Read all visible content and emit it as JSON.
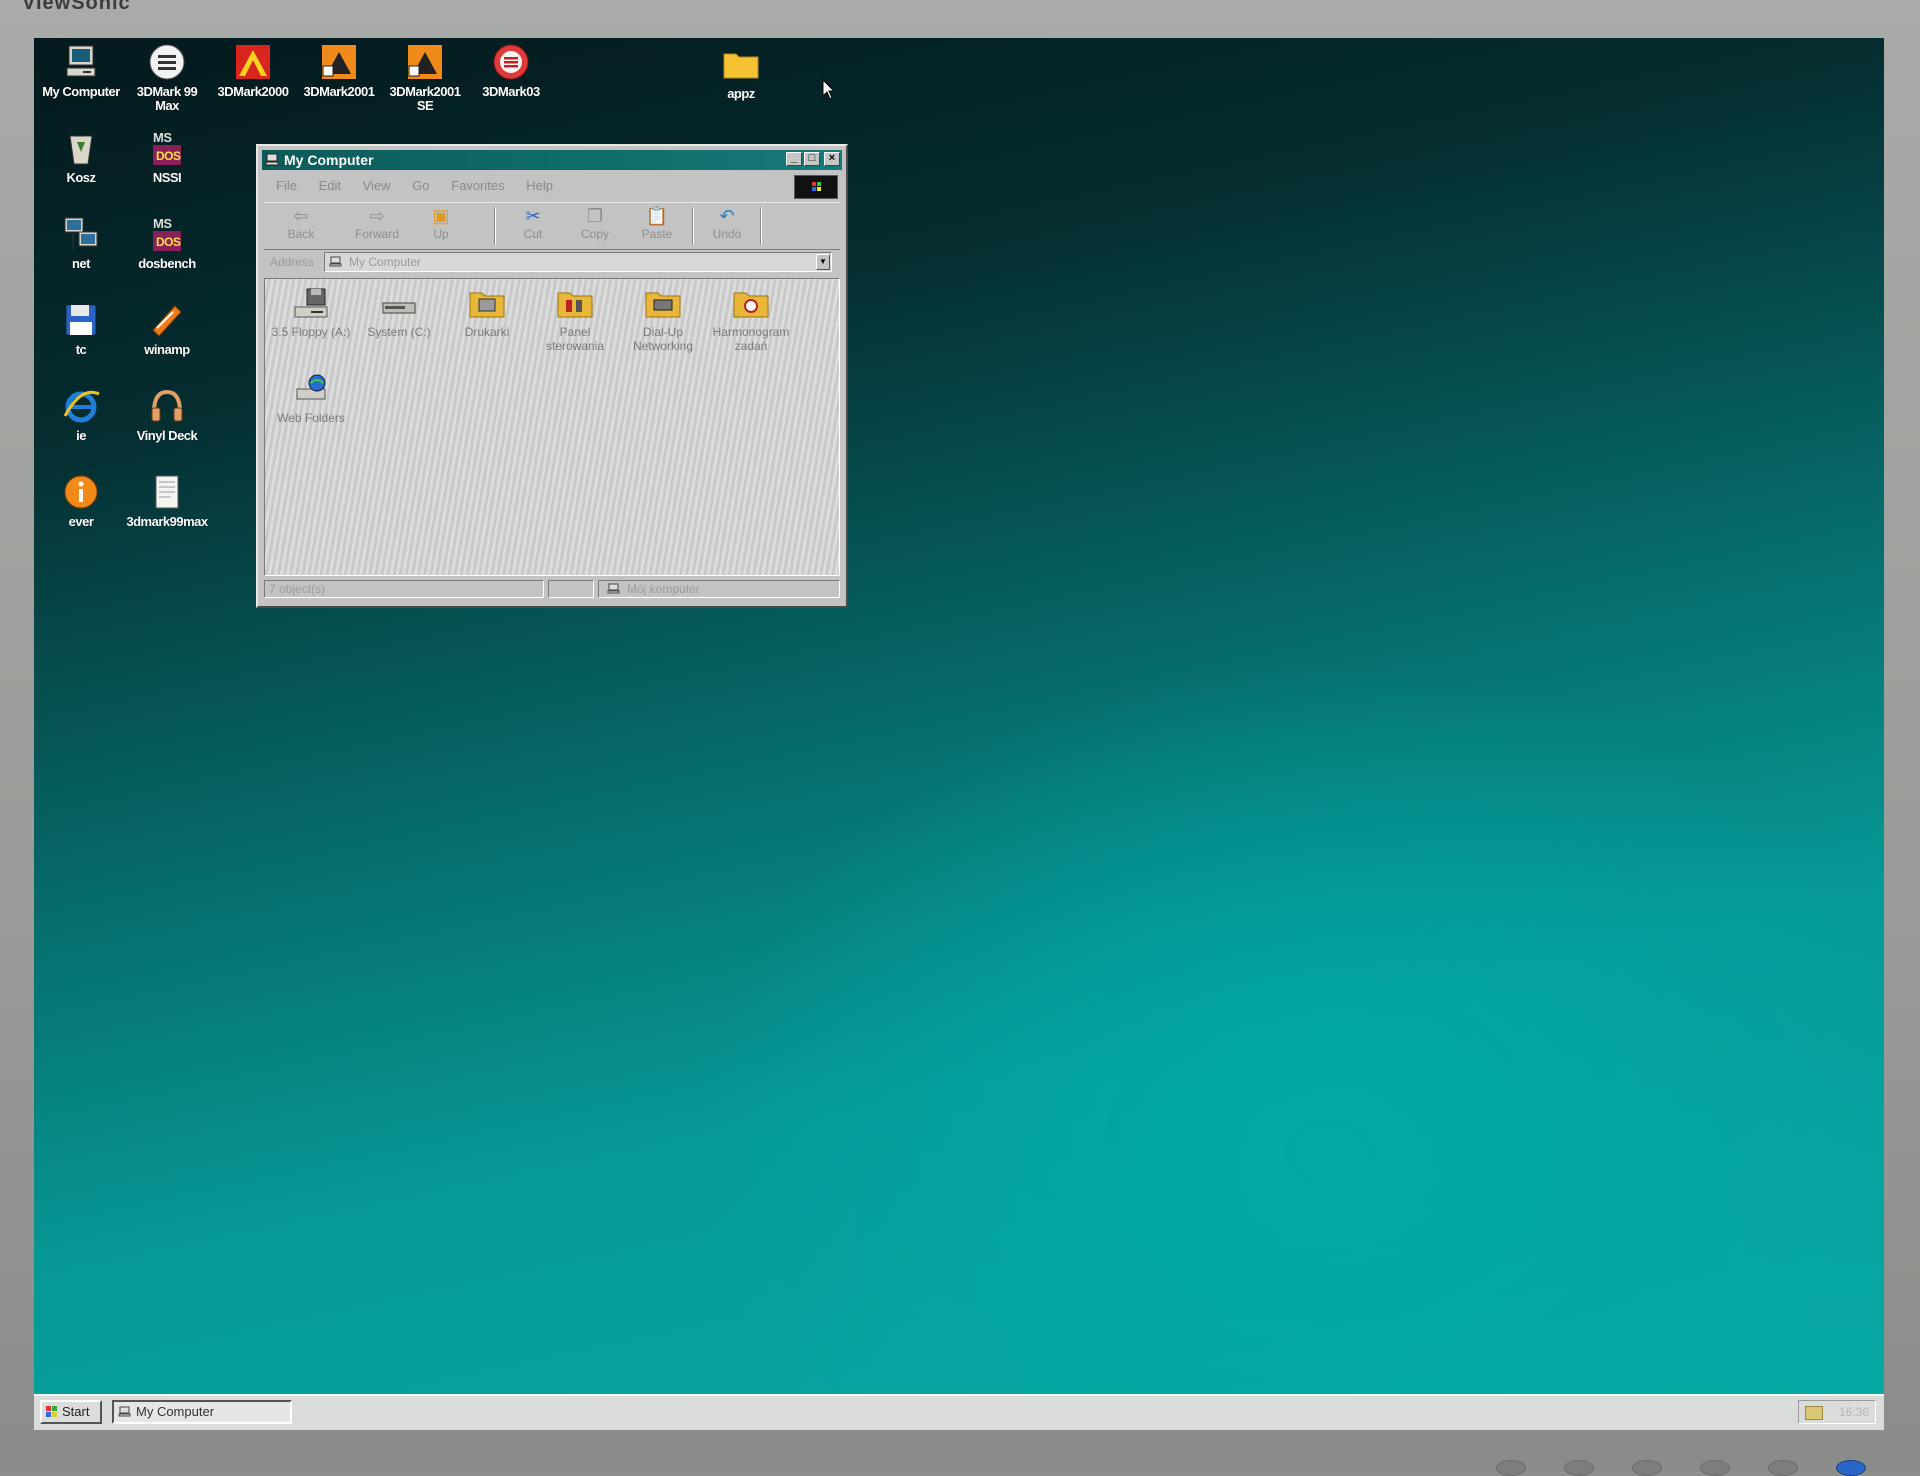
{
  "monitor": {
    "brand": "ViewSonic"
  },
  "desktop": {
    "icons": [
      {
        "label": "My Computer",
        "icon": "my-computer-icon"
      },
      {
        "label": "3DMark 99 Max",
        "icon": "3dmark-99-icon"
      },
      {
        "label": "3DMark2000",
        "icon": "3dmark-2000-icon"
      },
      {
        "label": "3DMark2001",
        "icon": "3dmark-2001-icon"
      },
      {
        "label": "3DMark2001 SE",
        "icon": "3dmark-2001se-icon"
      },
      {
        "label": "3DMark03",
        "icon": "3dmark-03-icon"
      },
      {
        "label": "appz",
        "icon": "folder-icon"
      },
      {
        "label": "Kosz",
        "icon": "recycle-bin-icon"
      },
      {
        "label": "NSSI",
        "icon": "ms-dos-icon"
      },
      {
        "label": "net",
        "icon": "network-icon"
      },
      {
        "label": "dosbench",
        "icon": "ms-dos-icon"
      },
      {
        "label": "tc",
        "icon": "floppy-disk-icon"
      },
      {
        "label": "winamp",
        "icon": "winamp-icon"
      },
      {
        "label": "ie",
        "icon": "internet-explorer-icon"
      },
      {
        "label": "Vinyl Deck",
        "icon": "headphones-icon"
      },
      {
        "label": "ever",
        "icon": "everest-info-icon"
      },
      {
        "label": "3dmark99max",
        "icon": "document-icon"
      }
    ]
  },
  "window": {
    "title": "My Computer",
    "menu": [
      "File",
      "Edit",
      "View",
      "Go",
      "Favorites",
      "Help"
    ],
    "toolbar": [
      {
        "label": "Back",
        "icon": "back-arrow-icon",
        "glyph": "⇦"
      },
      {
        "label": "Forward",
        "icon": "forward-arrow-icon",
        "glyph": "⇨"
      },
      {
        "label": "Up",
        "icon": "up-folder-icon",
        "glyph": "▣"
      },
      {
        "label": "Cut",
        "icon": "scissors-icon",
        "glyph": "✂"
      },
      {
        "label": "Copy",
        "icon": "copy-icon",
        "glyph": "❐"
      },
      {
        "label": "Paste",
        "icon": "paste-icon",
        "glyph": "📋"
      },
      {
        "label": "Undo",
        "icon": "undo-icon",
        "glyph": "↶"
      }
    ],
    "address": {
      "label": "Address",
      "value": "My Computer"
    },
    "items": [
      {
        "label": "3.5 Floppy (A:)",
        "icon": "floppy-drive-icon"
      },
      {
        "label": "System (C:)",
        "icon": "hard-drive-icon"
      },
      {
        "label": "Drukarki",
        "icon": "printers-folder-icon"
      },
      {
        "label": "Panel sterowania",
        "icon": "control-panel-icon"
      },
      {
        "label": "Dial-Up Networking",
        "icon": "dialup-networking-icon"
      },
      {
        "label": "Harmonogram zadań",
        "icon": "scheduled-tasks-icon"
      },
      {
        "label": "Web Folders",
        "icon": "web-folders-icon"
      }
    ],
    "status": {
      "count": "7 object(s)",
      "location": "Mój komputer"
    }
  },
  "taskbar": {
    "start_label": "Start",
    "tasks": [
      {
        "label": "My Computer"
      }
    ],
    "clock": "16:36"
  },
  "colors": {
    "desktop_teal": "#08aaa6",
    "titlebar": "#0c5b5a",
    "window_face": "#c3c3c3"
  }
}
